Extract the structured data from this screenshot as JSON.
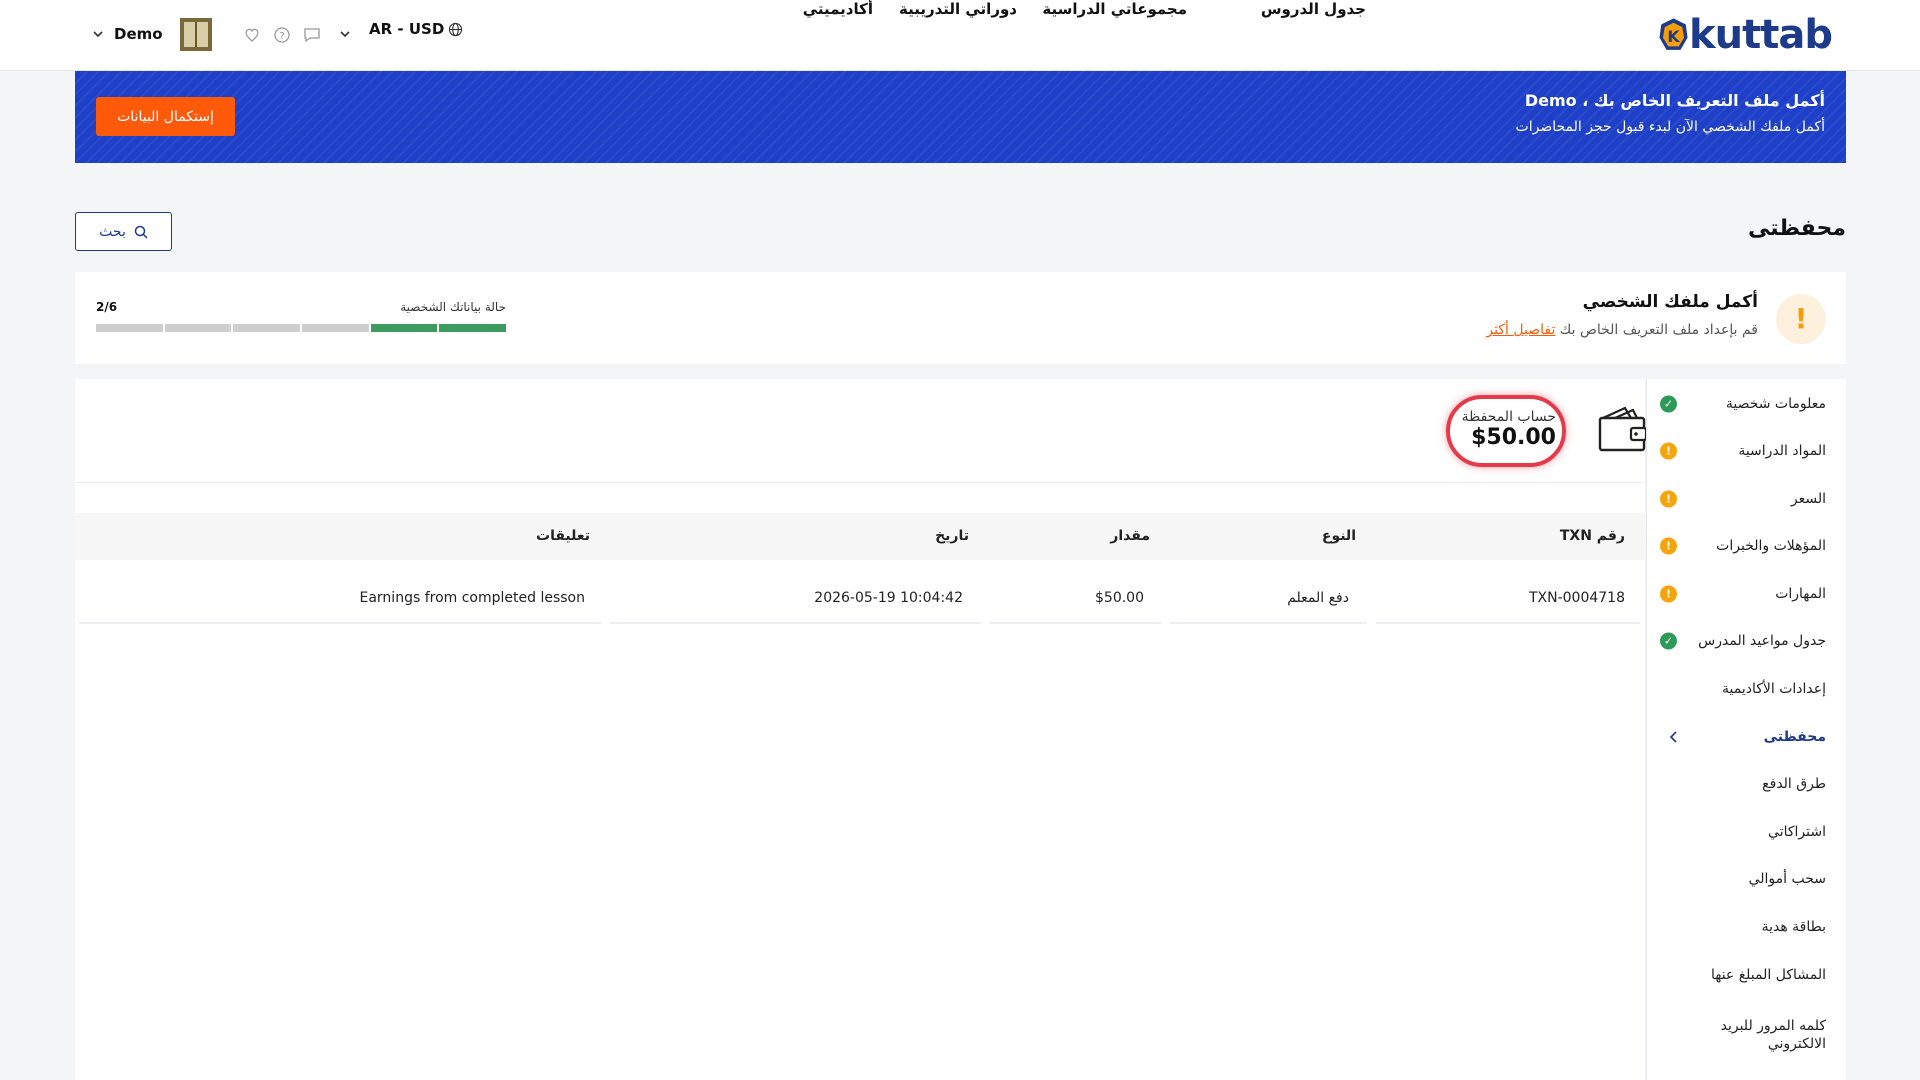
{
  "header": {
    "logo_text": "kuttab",
    "nav": [
      "جدول الدروس",
      "مجموعاتي الدراسية",
      "دوراتي التدريبية",
      "أكاديميتي"
    ],
    "locale": "AR - USD",
    "user_name": "Demo",
    "icons": [
      "globe-icon",
      "chevron-down-icon",
      "chat-icon",
      "help-icon",
      "heart-icon",
      "avatar"
    ]
  },
  "banner": {
    "title": "أكمل ملف التعريف الخاص بك ، Demo",
    "subtitle": "أكمل ملفك الشخصي الآن لبدء قبول حجز المحاضرات",
    "button": "إستكمال البيانات"
  },
  "page": {
    "title": "محفظتى",
    "search_label": "بحث"
  },
  "profile": {
    "title": "أكمل ملفك الشخصي",
    "subtitle": "قم بإعداد ملف التعريف الخاص بك",
    "link": "تفاصيل أكثر",
    "status_label": "حالة بياناتك الشخصية",
    "count": "2/6",
    "completed_steps": 2,
    "total_steps": 6
  },
  "sidebar": {
    "items": [
      {
        "label": "معلومات شخصية",
        "status": "ok"
      },
      {
        "label": "المواد الدراسية",
        "status": "warn"
      },
      {
        "label": "السعر",
        "status": "warn"
      },
      {
        "label": "المؤهلات والخبرات",
        "status": "warn"
      },
      {
        "label": "المهارات",
        "status": "warn"
      },
      {
        "label": "جدول مواعيد المدرس",
        "status": "ok"
      },
      {
        "label": "إعدادات الأكاديمية",
        "status": ""
      },
      {
        "label": "محفظتى",
        "status": "active"
      },
      {
        "label": "طرق الدفع",
        "status": ""
      },
      {
        "label": "اشتراكاتي",
        "status": ""
      },
      {
        "label": "سحب أموالي",
        "status": ""
      },
      {
        "label": "بطاقة هدية",
        "status": ""
      },
      {
        "label": "المشاكل المبلغ عنها",
        "status": ""
      },
      {
        "label": "كلمه المرور للبريد الالكتروني",
        "status": ""
      }
    ]
  },
  "wallet": {
    "label": "حساب المحفظة",
    "amount": "$50.00"
  },
  "table": {
    "headers": [
      "رقم TXN",
      "النوع",
      "مقدار",
      "تاريخ",
      "تعليقات"
    ],
    "rows": [
      [
        "TXN-0004718",
        "دفع المعلم",
        "$50.00",
        "2026-05-19 10:04:42",
        "Earnings from completed lesson"
      ]
    ]
  },
  "colors": {
    "brand_blue": "#1e3fc7",
    "accent_orange": "#ff5a0a",
    "ok_green": "#2e9a5a",
    "warn_amber": "#f5a50c",
    "highlight_red": "#e53a4a"
  }
}
